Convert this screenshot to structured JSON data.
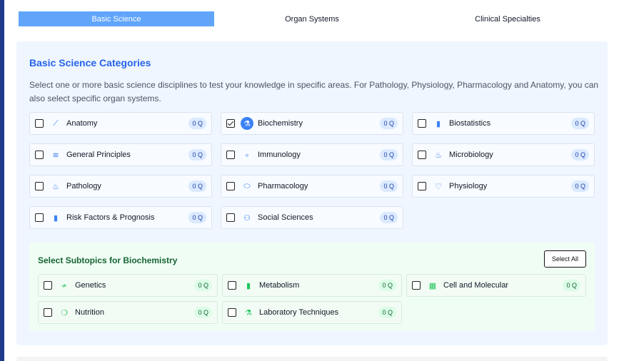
{
  "tabs": [
    {
      "label": "Basic Science",
      "active": true
    },
    {
      "label": "Organ Systems",
      "active": false
    },
    {
      "label": "Clinical Specialties",
      "active": false
    }
  ],
  "panel": {
    "title": "Basic Science Categories",
    "description": "Select one or more basic science disciplines to test your knowledge in specific areas. For Pathology, Physiology, Pharmacology and Anatomy, you can also select specific organ systems."
  },
  "categories": [
    {
      "label": "Anatomy",
      "count": "0 Q",
      "checked": false,
      "icon": "bone-icon"
    },
    {
      "label": "Biochemistry",
      "count": "0 Q",
      "checked": true,
      "icon": "flask-icon"
    },
    {
      "label": "Biostatistics",
      "count": "0 Q",
      "checked": false,
      "icon": "bar-chart-icon"
    },
    {
      "label": "General Principles",
      "count": "0 Q",
      "checked": false,
      "icon": "layers-icon"
    },
    {
      "label": "Immunology",
      "count": "0 Q",
      "checked": false,
      "icon": "cells-icon"
    },
    {
      "label": "Microbiology",
      "count": "0 Q",
      "checked": false,
      "icon": "microscope-icon"
    },
    {
      "label": "Pathology",
      "count": "0 Q",
      "checked": false,
      "icon": "microscope-icon"
    },
    {
      "label": "Pharmacology",
      "count": "0 Q",
      "checked": false,
      "icon": "pill-icon"
    },
    {
      "label": "Physiology",
      "count": "0 Q",
      "checked": false,
      "icon": "heart-icon"
    },
    {
      "label": "Risk Factors & Prognosis",
      "count": "0 Q",
      "checked": false,
      "icon": "bar-chart-icon"
    },
    {
      "label": "Social Sciences",
      "count": "0 Q",
      "checked": false,
      "icon": "people-icon"
    }
  ],
  "subtopics": {
    "title": "Select Subtopics for Biochemistry",
    "select_all_label": "Select All",
    "items": [
      {
        "label": "Genetics",
        "count": "0 Q",
        "checked": false,
        "icon": "dna-icon"
      },
      {
        "label": "Metabolism",
        "count": "0 Q",
        "checked": false,
        "icon": "bar-chart-icon"
      },
      {
        "label": "Cell and Molecular",
        "count": "0 Q",
        "checked": false,
        "icon": "grid-icon"
      },
      {
        "label": "Nutrition",
        "count": "0 Q",
        "checked": false,
        "icon": "apple-icon"
      },
      {
        "label": "Laboratory Techniques",
        "count": "0 Q",
        "checked": false,
        "icon": "beaker-icon"
      }
    ]
  }
}
